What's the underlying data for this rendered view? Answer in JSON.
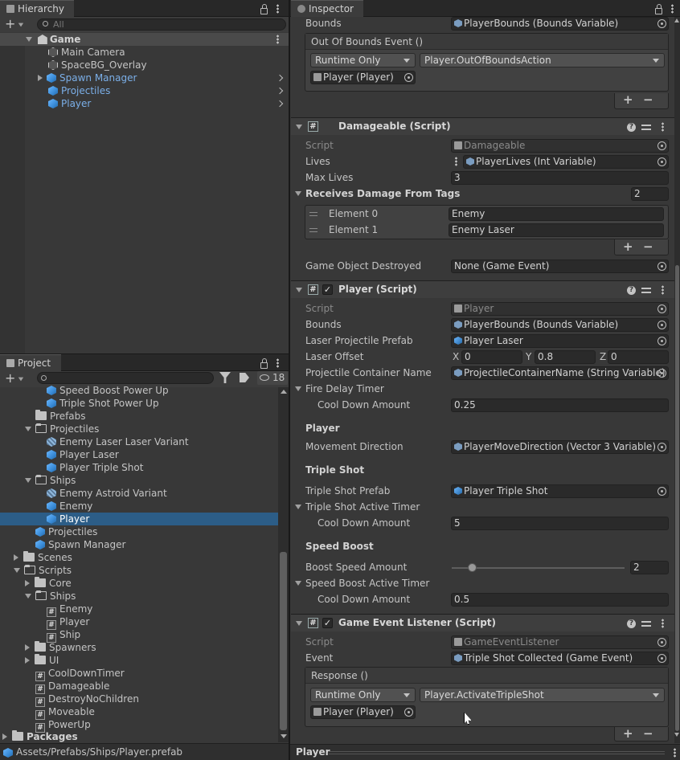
{
  "hierarchy": {
    "tab": "Hierarchy",
    "search_placeholder": "All",
    "scene": "Game",
    "items": [
      {
        "label": "Main Camera",
        "type": "gray"
      },
      {
        "label": "SpaceBG_Overlay",
        "type": "gray"
      },
      {
        "label": "Spawn Manager",
        "type": "blue"
      },
      {
        "label": "Projectiles",
        "type": "blue"
      },
      {
        "label": "Player",
        "type": "blue"
      }
    ]
  },
  "project": {
    "tab": "Project",
    "hidden_count": "18",
    "tree": [
      {
        "label": "Speed Boost Power Up"
      },
      {
        "label": "Triple Shot Power Up"
      },
      {
        "label": "Prefabs"
      },
      {
        "label": "Projectiles"
      },
      {
        "label": "Enemy Laser Laser Variant"
      },
      {
        "label": "Player Laser"
      },
      {
        "label": "Player Triple Shot"
      },
      {
        "label": "Ships"
      },
      {
        "label": "Enemy Astroid Variant"
      },
      {
        "label": "Enemy"
      },
      {
        "label": "Player"
      },
      {
        "label": "Projectiles"
      },
      {
        "label": "Spawn Manager"
      },
      {
        "label": "Scenes"
      },
      {
        "label": "Scripts"
      },
      {
        "label": "Core"
      },
      {
        "label": "Ships"
      },
      {
        "label": "Enemy"
      },
      {
        "label": "Player"
      },
      {
        "label": "Ship"
      },
      {
        "label": "Spawners"
      },
      {
        "label": "UI"
      },
      {
        "label": "CoolDownTimer"
      },
      {
        "label": "Damageable"
      },
      {
        "label": "DestroyNoChildren"
      },
      {
        "label": "Moveable"
      },
      {
        "label": "PowerUp"
      },
      {
        "label": "Packages"
      }
    ],
    "path": "Assets/Prefabs/Ships/Player.prefab"
  },
  "inspector": {
    "tab": "Inspector",
    "top": {
      "bounds_label": "Bounds",
      "bounds_value": "PlayerBounds (Bounds Variable)",
      "event_title": "Out Of Bounds Event ()",
      "runtime": "Runtime Only",
      "method": "Player.OutOfBoundsAction",
      "target": "Player (Player)"
    },
    "damageable": {
      "title": "Damageable (Script)",
      "script_label": "Script",
      "script_value": "Damageable",
      "lives_label": "Lives",
      "lives_value": "PlayerLives (Int Variable)",
      "maxlives_label": "Max Lives",
      "maxlives_value": "3",
      "tags_label": "Receives Damage From Tags",
      "tags_count": "2",
      "el0_label": "Element 0",
      "el0_value": "Enemy",
      "el1_label": "Element 1",
      "el1_value": "Enemy Laser",
      "destroyed_label": "Game Object Destroyed",
      "destroyed_value": "None (Game Event)"
    },
    "player": {
      "title": "Player (Script)",
      "script_label": "Script",
      "script_value": "Player",
      "bounds_label": "Bounds",
      "bounds_value": "PlayerBounds (Bounds Variable)",
      "laser_prefab_label": "Laser Projectile Prefab",
      "laser_prefab_value": "Player Laser",
      "laser_offset_label": "Laser Offset",
      "x_label": "X",
      "x_value": "0",
      "y_label": "Y",
      "y_value": "0.8",
      "z_label": "Z",
      "z_value": "0",
      "container_label": "Projectile Container Name",
      "container_value": "ProjectileContainerName (String Variable)",
      "fire_delay_label": "Fire Delay Timer",
      "cooldown1_label": "Cool Down Amount",
      "cooldown1_value": "0.25",
      "player_section": "Player",
      "movedir_label": "Movement Direction",
      "movedir_value": "PlayerMoveDirection (Vector 3 Variable)",
      "triple_section": "Triple Shot",
      "triple_prefab_label": "Triple Shot Prefab",
      "triple_prefab_value": "Player Triple Shot",
      "triple_timer_label": "Triple Shot Active Timer",
      "cooldown2_label": "Cool Down Amount",
      "cooldown2_value": "5",
      "speed_section": "Speed Boost",
      "boost_amount_label": "Boost Speed Amount",
      "boost_amount_value": "2",
      "boost_slider_fraction": 0.12,
      "speed_timer_label": "Speed Boost Active Timer",
      "cooldown3_label": "Cool Down Amount",
      "cooldown3_value": "0.5"
    },
    "listener": {
      "title": "Game Event Listener (Script)",
      "script_label": "Script",
      "script_value": "GameEventListener",
      "event_label": "Event",
      "event_value": "Triple Shot Collected (Game Event)",
      "response_title": "Response ()",
      "runtime": "Runtime Only",
      "method": "Player.ActivateTripleShot",
      "target": "Player (Player)"
    },
    "footer": "Player"
  }
}
